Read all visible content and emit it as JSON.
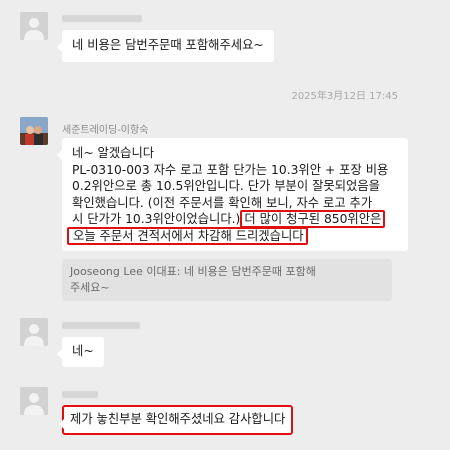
{
  "messages": {
    "m1": {
      "text": "네 비용은 담번주문때 포함해주세요~"
    },
    "timestamp": "2025年3月12日 17:45",
    "m2": {
      "sender": "세준트레이딩-이항숙",
      "lines": {
        "l1": "네~ 알겠습니다",
        "l2": "PL-0310-003 자수 로고 포함 단가는 10.3위안 + 포장 비용",
        "l3": "0.2위안으로 총 10.5위안입니다. 단가 부분이 잘못되었음을",
        "l4": "확인했습니다. (이전 주문서를 확인해 보니, 자수 로고 추가",
        "l5a": "시 단가가 10.3위안이었습니다.)",
        "l5b": "더 많이 청구된 850위안은",
        "l6": "오늘 주문서 견적서에서 차감해 드리겠습니다"
      },
      "quote": {
        "l1": "Jooseong Lee 이대표: 네 비용은 담번주문때 포함해",
        "l2": "주세요~"
      }
    },
    "m3": {
      "text": "네~"
    },
    "m4": {
      "text": "제가 놓친부분 확인해주셨네요 감사합니다"
    }
  },
  "colors": {
    "background": "#ededed",
    "bubble": "#ffffff",
    "highlight": "#e01010",
    "quote_bg": "#e2e2e2"
  }
}
